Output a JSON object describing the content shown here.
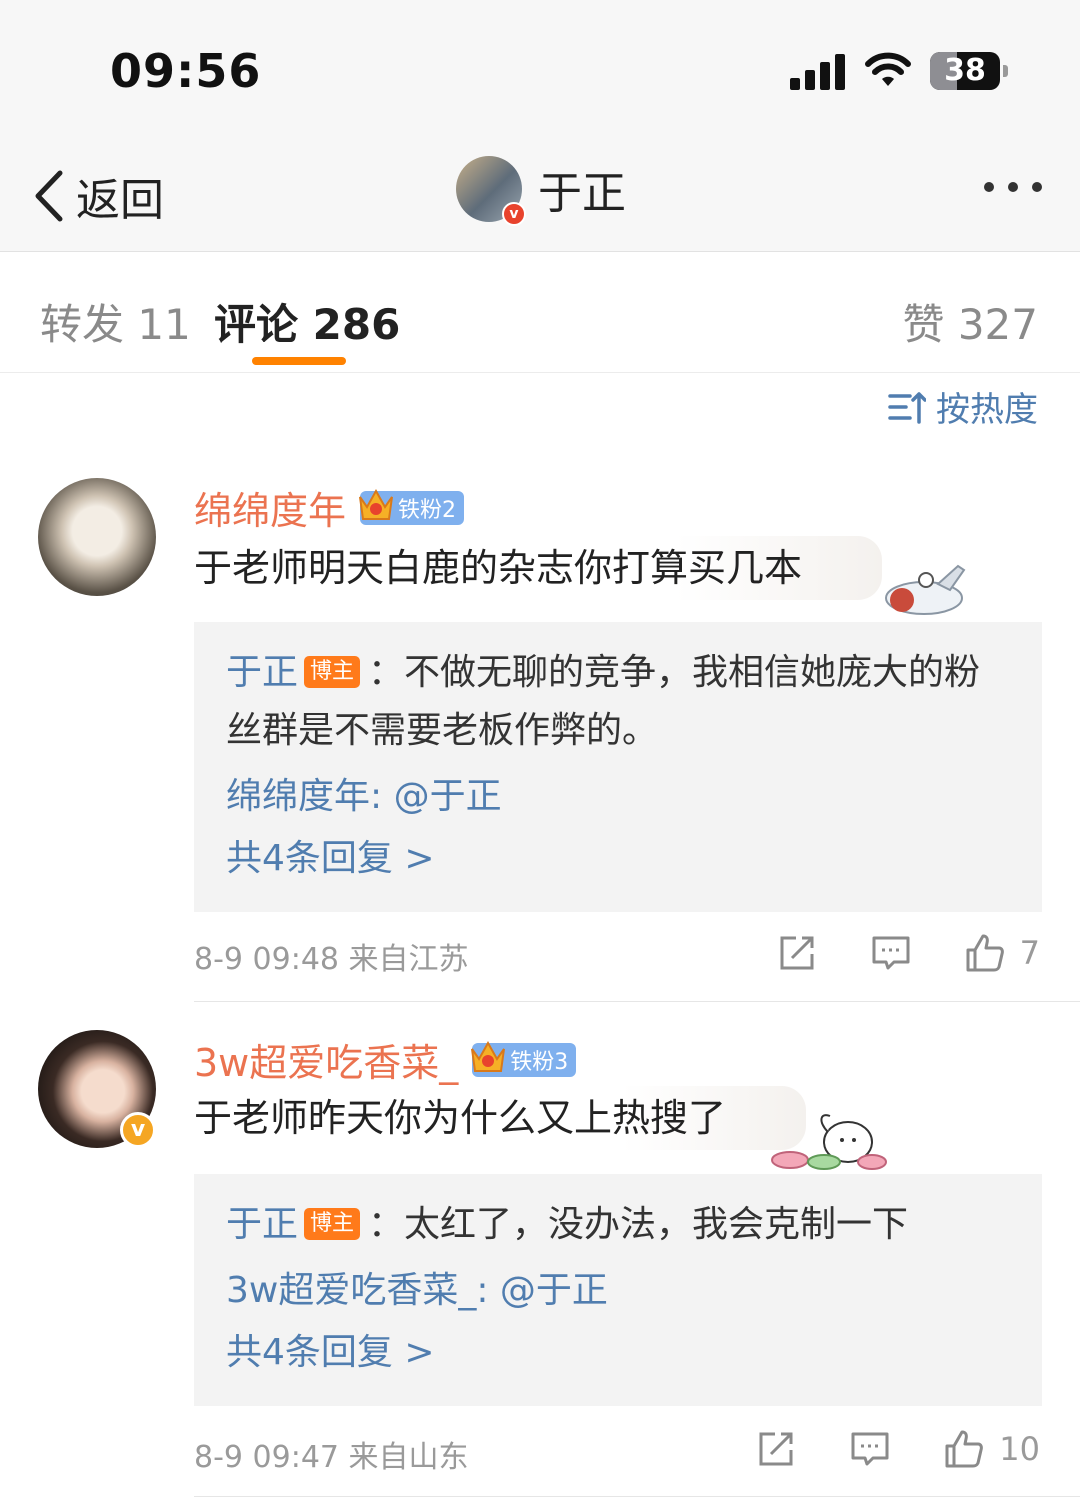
{
  "status_bar": {
    "time": "09:56",
    "battery": "38"
  },
  "nav": {
    "back_label": "返回",
    "title": "于正",
    "verified_mark": "v"
  },
  "tabs": [
    {
      "label": "转发 11"
    },
    {
      "label": "评论 286"
    },
    {
      "label": "赞 327"
    }
  ],
  "sort": {
    "label": "按热度",
    "icon": "sort-icon"
  },
  "comments": [
    {
      "username": "绵绵度年",
      "fan_badge": "铁粉2",
      "text": "于老师明天白鹿的杂志你打算买几本",
      "replies": [
        {
          "author": "于正",
          "tag": "博主",
          "text": "：不做无聊的竞争，我相信她庞大的粉丝群是不需要老板作弊的。"
        },
        {
          "author": "绵绵度年:",
          "text": " @于正"
        }
      ],
      "more_replies": "共4条回复 >",
      "time_location": "8-9 09:48  来自江苏",
      "like_count": "7"
    },
    {
      "username": "3w超爱吃香菜_",
      "fan_badge": "铁粉3",
      "avatar_badge": "v",
      "text": "于老师昨天你为什么又上热搜了",
      "replies": [
        {
          "author": "于正",
          "tag": "博主",
          "text": "：太红了，没办法，我会克制一下"
        },
        {
          "author": "3w超爱吃香菜_:",
          "text": " @于正"
        }
      ],
      "more_replies": "共4条回复 >",
      "time_location": "8-9 09:47  来自山东",
      "like_count": "10"
    }
  ],
  "colors": {
    "accent": "#ff8200",
    "link": "#507daf",
    "username": "#eb7350",
    "host_tag": "#ff7a1a",
    "fan_badge": "#7fb0ee"
  }
}
